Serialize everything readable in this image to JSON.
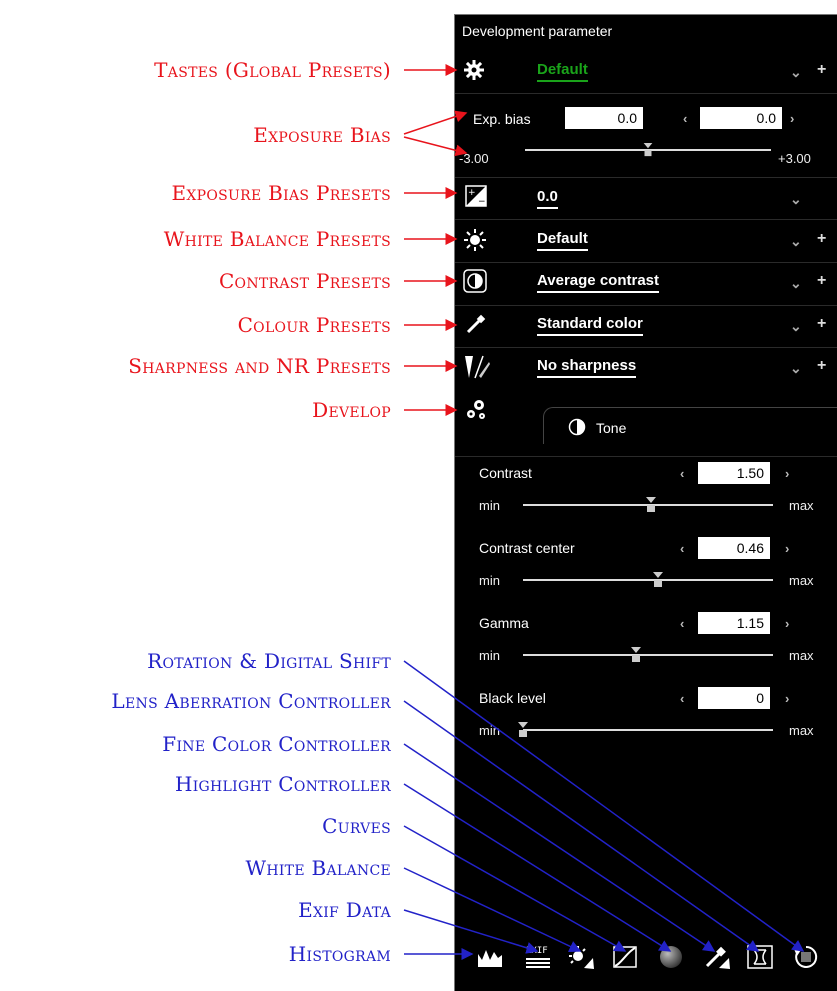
{
  "annotations": {
    "tastes": "Tastes (Global Presets)",
    "exposure_bias": "Exposure Bias",
    "exposure_bias_presets": "Exposure Bias Presets",
    "white_balance_presets": "White Balance Presets",
    "contrast_presets": "Contrast Presets",
    "colour_presets": "Colour Presets",
    "sharpness_nr_presets": "Sharpness and NR Presets",
    "develop": "Develop",
    "rotation": "Rotation & Digital Shift",
    "lens_aberration": "Lens Aberration Controller",
    "fine_color": "Fine Color Controller",
    "highlight": "Highlight Controller",
    "curves": "Curves",
    "white_balance": "White Balance",
    "exif": "Exif Data",
    "histogram": "Histogram"
  },
  "panel": {
    "title": "Development parameter",
    "tastes_value": "Default",
    "exp_bias_label": "Exp. bias",
    "exp_bias_value1": "0.0",
    "exp_bias_value2": "0.0",
    "exp_min": "-3.00",
    "exp_max": "+3.00",
    "exp_preset": "0.0",
    "wb_preset": "Default",
    "contrast_preset": "Average contrast",
    "color_preset": "Standard color",
    "sharpness_preset": "No sharpness",
    "tab_label": "Tone",
    "slider_min": "min",
    "slider_max": "max",
    "sliders": [
      {
        "label": "Contrast",
        "value": "1.50",
        "fraction": 0.51
      },
      {
        "label": "Contrast center",
        "value": "0.46",
        "fraction": 0.54
      },
      {
        "label": "Gamma",
        "value": "1.15",
        "fraction": 0.45
      },
      {
        "label": "Black level",
        "value": "0",
        "fraction": 0.0
      }
    ],
    "exif_icon_text": "EXIF"
  },
  "colors": {
    "red": "#e8141c",
    "blue": "#2222c8",
    "green": "#1aa31a"
  }
}
